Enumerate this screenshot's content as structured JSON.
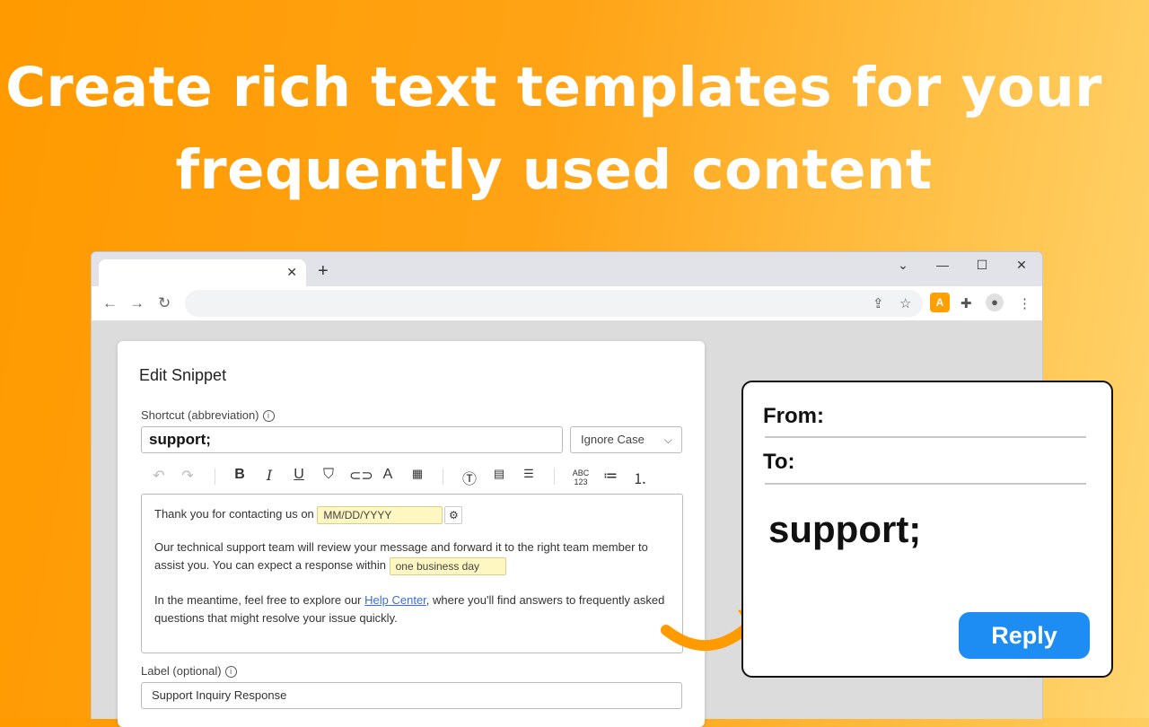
{
  "headline": {
    "line1": "Create rich text templates for your",
    "line2": "frequently used content"
  },
  "browser": {
    "new_tab": "+",
    "tab_close": "✕",
    "window_controls": {
      "dropdown": "⌄",
      "minimize": "—",
      "maximize": "☐",
      "close": "✕"
    },
    "nav": {
      "back": "←",
      "forward": "→",
      "reload": "↻"
    },
    "extension_label": "A"
  },
  "snippet": {
    "title": "Edit Snippet",
    "shortcut_label": "Shortcut (abbreviation)",
    "shortcut_value": "support;",
    "case_option": "Ignore Case",
    "body": {
      "p1_text": "Thank you for contacting us on",
      "p1_chip": "MM/DD/YYYY",
      "p2_text": "Our technical support team will review your message and forward it to the right team member to assist you. You can expect a response within",
      "p2_chip": "one business day",
      "p3_before": "In the meantime, feel free to explore our",
      "p3_link": "Help Center",
      "p3_after": ", where you'll find answers to frequently asked questions that might resolve your issue quickly."
    },
    "label_label": "Label (optional)",
    "label_value": "Support Inquiry Response"
  },
  "preview": {
    "from_label": "From:",
    "to_label": "To:",
    "body": "support;",
    "reply_label": "Reply"
  },
  "colors": {
    "accent_orange": "#ff9a00",
    "reply_blue": "#1d8df3",
    "chip_yellow": "#fff7c2",
    "link_blue": "#3a6fd1"
  }
}
